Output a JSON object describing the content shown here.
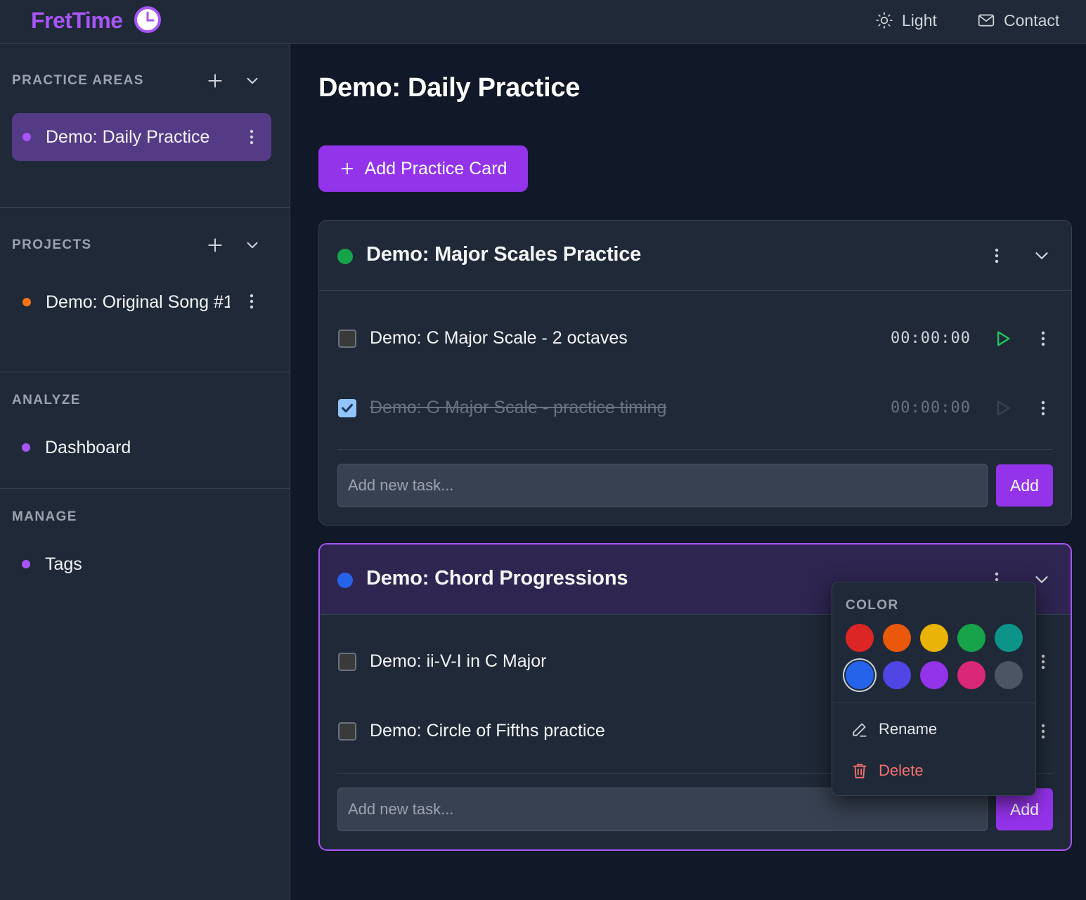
{
  "app": {
    "name": "FretTime"
  },
  "topbar": {
    "theme_label": "Light",
    "contact_label": "Contact"
  },
  "sidebar": {
    "practice_areas": {
      "title": "PRACTICE AREAS",
      "items": [
        {
          "label": "Demo: Daily Practice",
          "dot_color": "#a855f7",
          "active": true
        }
      ]
    },
    "projects": {
      "title": "PROJECTS",
      "items": [
        {
          "label": "Demo: Original Song #1",
          "dot_color": "#f97316"
        }
      ]
    },
    "analyze": {
      "title": "ANALYZE",
      "items": [
        {
          "label": "Dashboard",
          "dot_color": "#a855f7"
        }
      ]
    },
    "manage": {
      "title": "MANAGE",
      "items": [
        {
          "label": "Tags",
          "dot_color": "#a855f7"
        }
      ]
    }
  },
  "main": {
    "title": "Demo: Daily Practice",
    "add_card_label": "Add Practice Card",
    "cards": [
      {
        "title": "Demo: Major Scales Practice",
        "dot_color": "#16a34a",
        "tasks": [
          {
            "label": "Demo: C Major Scale - 2 octaves",
            "timer": "00:00:00",
            "done": false
          },
          {
            "label": "Demo: G Major Scale - practice timing",
            "timer": "00:00:00",
            "done": true
          }
        ],
        "input_placeholder": "Add new task...",
        "add_label": "Add"
      },
      {
        "title": "Demo: Chord Progressions",
        "dot_color": "#2563eb",
        "tasks": [
          {
            "label": "Demo: ii-V-I in C Major",
            "done": false
          },
          {
            "label": "Demo: Circle of Fifths practice",
            "done": false
          }
        ],
        "input_placeholder": "Add new task...",
        "add_label": "Add"
      }
    ]
  },
  "popover": {
    "color_title": "COLOR",
    "colors": [
      "#dc2626",
      "#ea580c",
      "#eab308",
      "#16a34a",
      "#0d9488",
      "#2563eb",
      "#4f46e5",
      "#9333ea",
      "#db2777",
      "#4b5563"
    ],
    "selected_color": "#2563eb",
    "rename_label": "Rename",
    "delete_label": "Delete",
    "delete_color": "#f87171"
  },
  "colors": {
    "accent": "#9333ea",
    "brand": "#a855f7"
  }
}
